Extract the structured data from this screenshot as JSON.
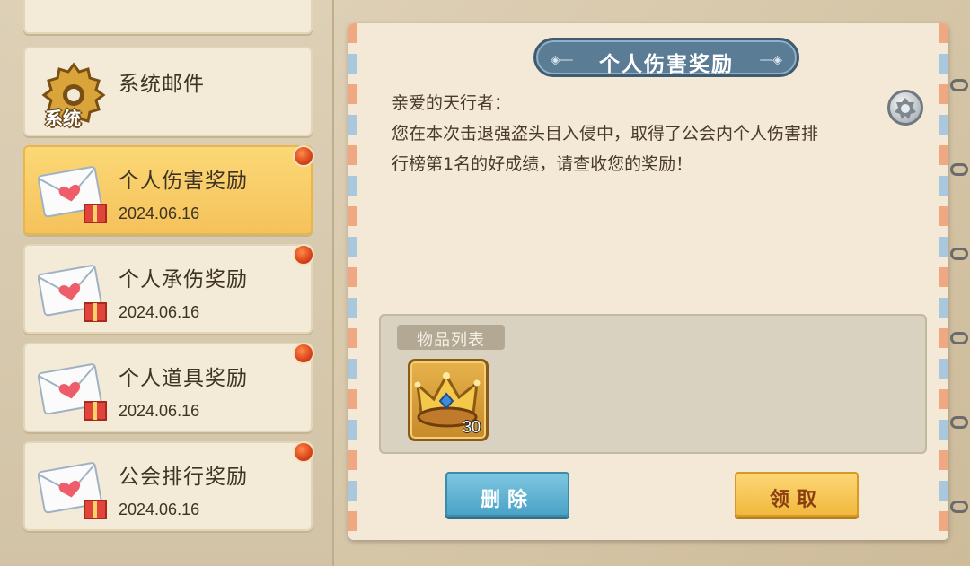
{
  "sidebar": {
    "items": [
      {
        "label": "系统邮件",
        "badge": "系统",
        "icon": "gear-icon",
        "date": "",
        "unread": false,
        "active": false
      },
      {
        "label": "个人伤害奖励",
        "date": "2024.06.16",
        "icon": "envelope-heart-icon",
        "unread": true,
        "active": true
      },
      {
        "label": "个人承伤奖励",
        "date": "2024.06.16",
        "icon": "envelope-heart-icon",
        "unread": true,
        "active": false
      },
      {
        "label": "个人道具奖励",
        "date": "2024.06.16",
        "icon": "envelope-heart-icon",
        "unread": true,
        "active": false
      },
      {
        "label": "公会排行奖励",
        "date": "2024.06.16",
        "icon": "envelope-heart-icon",
        "unread": true,
        "active": false
      }
    ]
  },
  "mail": {
    "title": "个人伤害奖励",
    "greeting": "亲爱的天行者：",
    "body_line1": "您在本次击退强盗头目入侵中，取得了公会内个人伤害排",
    "body_line2": "行榜第1名的好成绩，请查收您的奖励！",
    "items_label": "物品列表",
    "items": [
      {
        "icon": "crown-icon",
        "count": "30"
      }
    ]
  },
  "buttons": {
    "delete": "删除",
    "claim": "领取"
  },
  "colors": {
    "active_item": "#f5c25b",
    "banner": "#5b7c95",
    "delete": "#4aa3c7",
    "claim": "#f1b93e",
    "unread": "#d9431a"
  }
}
